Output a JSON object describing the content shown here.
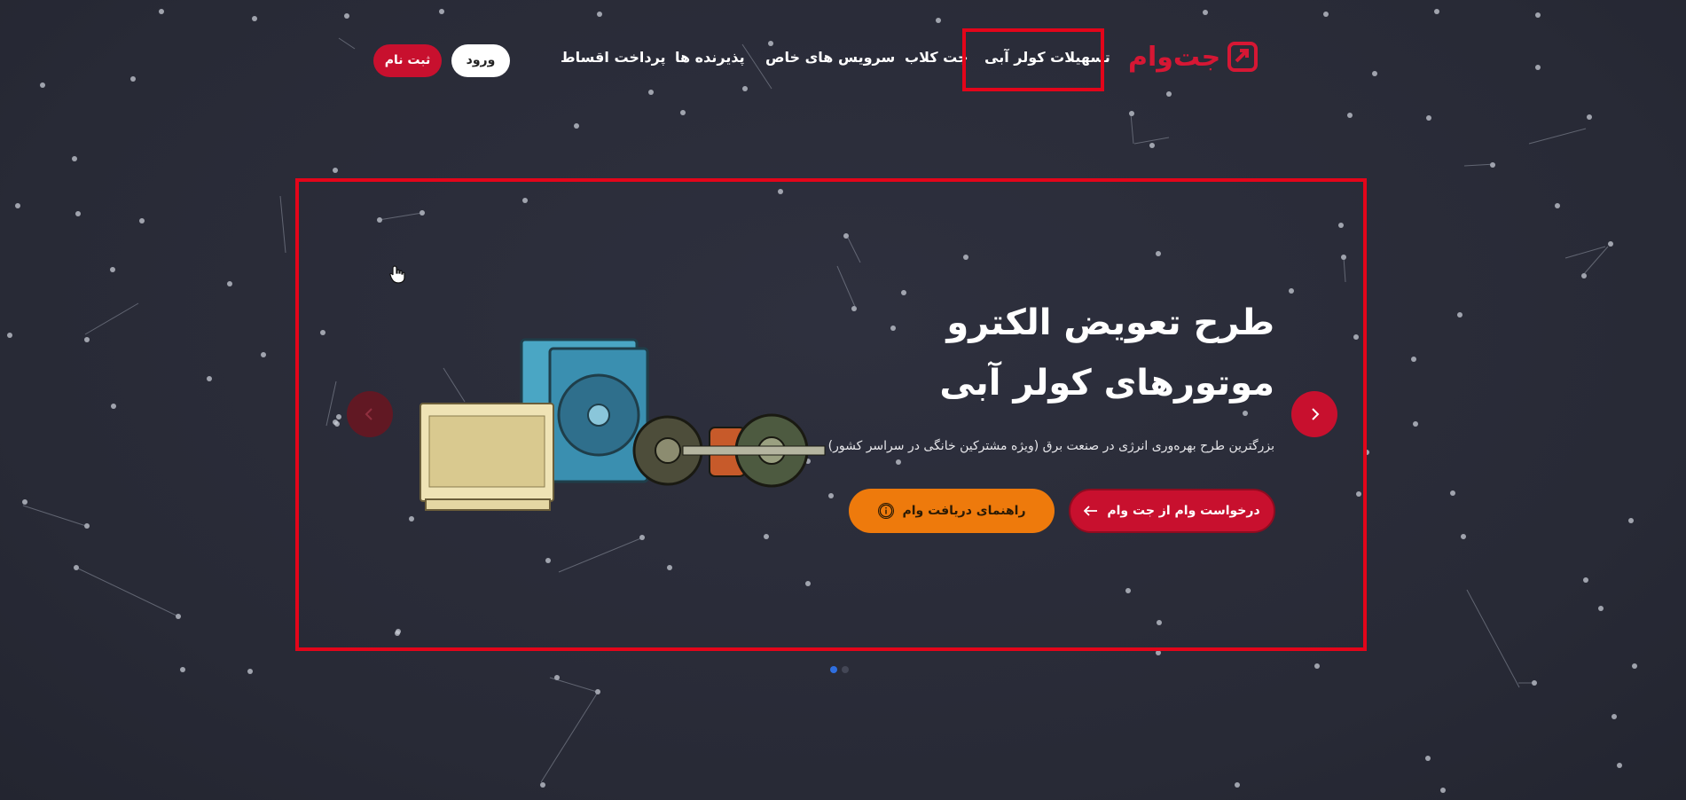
{
  "header": {
    "logo_text": "جت‌وام",
    "nav": [
      {
        "label": "تسهیلات کولر آبی"
      },
      {
        "label": "جت کلاب"
      },
      {
        "label": "سرویس های خاص"
      },
      {
        "label": "پذیرنده ها"
      },
      {
        "label": "پرداخت اقساط"
      }
    ],
    "login_label": "ورود",
    "register_label": "ثبت نام"
  },
  "hero": {
    "title_line1": "طرح تعویض الکترو",
    "title_line2": "موتورهای کولر آبی",
    "subtitle": "بزرگترین طرح بهره‌وری انرژی در صنعت برق (ویژه مشترکین خانگی در سراسر کشور)",
    "request_button": "درخواست وام از جت وام",
    "guide_button": "راهنمای دریافت وام"
  },
  "slider": {
    "active_index": 0,
    "count": 2
  },
  "colors": {
    "background": "#292b38",
    "brand_red": "#c8102e",
    "accent_orange": "#ee7a0c",
    "active_dot": "#2f6fe0",
    "annotation_red": "#e3051a"
  }
}
